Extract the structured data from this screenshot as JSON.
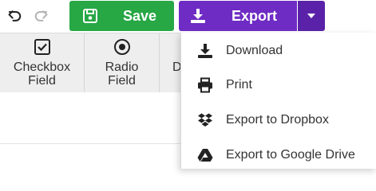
{
  "toolbar": {
    "undo_icon": "undo-icon",
    "redo_icon": "redo-icon",
    "save_label": "Save",
    "save_icon": "floppy-disk-icon",
    "export_label": "Export",
    "export_icon": "download-icon",
    "export_caret_icon": "caret-down-icon",
    "save_color": "#28a745",
    "export_color": "#6f2cc4"
  },
  "palette": {
    "fields": [
      {
        "line1": "Checkbox",
        "line2": "Field",
        "icon": "checkbox-icon"
      },
      {
        "line1": "Radio",
        "line2": "Field",
        "icon": "radio-icon"
      },
      {
        "line1": "D",
        "line2": "",
        "icon": ""
      }
    ]
  },
  "export_menu": {
    "items": [
      {
        "label": "Download",
        "icon": "download-icon"
      },
      {
        "label": "Print",
        "icon": "printer-icon"
      },
      {
        "label": "Export to Dropbox",
        "icon": "dropbox-icon"
      },
      {
        "label": "Export to Google Drive",
        "icon": "google-drive-icon"
      }
    ]
  }
}
